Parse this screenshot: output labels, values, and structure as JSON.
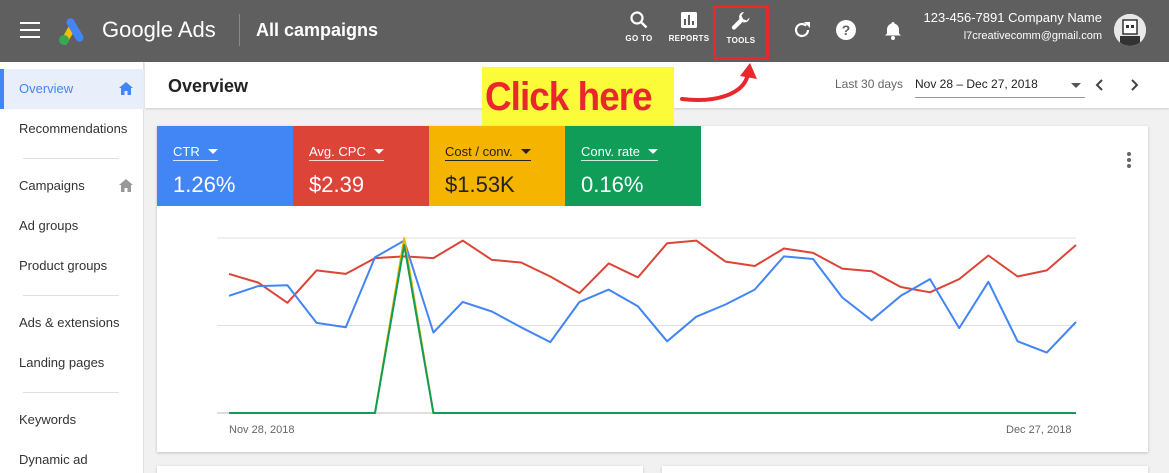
{
  "topbar": {
    "brand": "Google Ads",
    "page_title": "All campaigns",
    "buttons": {
      "goto": "GO TO",
      "reports": "REPORTS",
      "tools": "TOOLS"
    },
    "account_phone_company": "123-456-7891 Company Name",
    "account_email": "l7creativecomm@gmail.com",
    "icons": [
      "menu-icon",
      "google-ads-logo",
      "search-icon",
      "reports-icon",
      "wrench-icon",
      "refresh-icon",
      "help-icon",
      "bell-icon"
    ]
  },
  "callout": {
    "text": "Click here",
    "color": "#e8282c",
    "background": "#fbfb3a"
  },
  "sidebar": {
    "items": [
      {
        "label": "Overview",
        "active": true,
        "icon": "home-icon"
      },
      {
        "label": "Recommendations"
      },
      {
        "label": "Campaigns",
        "icon": "home-icon"
      },
      {
        "label": "Ad groups"
      },
      {
        "label": "Product groups"
      },
      {
        "label": "Ads & extensions"
      },
      {
        "label": "Landing pages"
      },
      {
        "label": "Keywords"
      },
      {
        "label": "Dynamic ad"
      }
    ]
  },
  "overview": {
    "title": "Overview",
    "range_label": "Last 30 days",
    "date_range": "Nov 28 – Dec 27, 2018"
  },
  "metrics": [
    {
      "label": "CTR",
      "value": "1.26%",
      "color": "#4285f4"
    },
    {
      "label": "Avg. CPC",
      "value": "$2.39",
      "color": "#db4437"
    },
    {
      "label": "Cost / conv.",
      "value": "$1.53K",
      "color": "#f4b400"
    },
    {
      "label": "Conv. rate",
      "value": "0.16%",
      "color": "#0f9d58"
    }
  ],
  "chart_data": {
    "type": "line",
    "x_start_label": "Nov 28, 2018",
    "x_end_label": "Dec 27, 2018",
    "x": [
      1,
      2,
      3,
      4,
      5,
      6,
      7,
      8,
      9,
      10,
      11,
      12,
      13,
      14,
      15,
      16,
      17,
      18,
      19,
      20,
      21,
      22,
      23,
      24,
      25,
      26,
      27,
      28,
      29,
      30
    ],
    "y_axis_labels": "none",
    "grid": true,
    "series": [
      {
        "name": "CTR",
        "color": "#4285f4",
        "values": [
          1.34,
          1.45,
          1.46,
          1.03,
          0.98,
          1.78,
          1.97,
          0.92,
          1.27,
          1.16,
          0.98,
          0.81,
          1.27,
          1.41,
          1.22,
          0.82,
          1.1,
          1.24,
          1.41,
          1.79,
          1.76,
          1.32,
          1.06,
          1.34,
          1.53,
          0.97,
          1.5,
          0.82,
          0.69,
          1.04
        ]
      },
      {
        "name": "Avg. CPC",
        "color": "#db4437",
        "values": [
          1.59,
          1.49,
          1.26,
          1.63,
          1.59,
          1.77,
          1.79,
          1.77,
          1.97,
          1.75,
          1.72,
          1.56,
          1.37,
          1.71,
          1.55,
          1.94,
          1.97,
          1.73,
          1.68,
          1.88,
          1.83,
          1.65,
          1.62,
          1.44,
          1.38,
          1.53,
          1.8,
          1.56,
          1.63,
          1.92
        ]
      },
      {
        "name": "Cost / conv.",
        "color": "#f4b400",
        "values": [
          0,
          0,
          0,
          0,
          0,
          0,
          2.0,
          0,
          0,
          0,
          0,
          0,
          0,
          0,
          0,
          0,
          0,
          0,
          0,
          0,
          0,
          0,
          0,
          0,
          0,
          0,
          0,
          0,
          0,
          0
        ]
      },
      {
        "name": "Conv. rate",
        "color": "#0f9d58",
        "values": [
          0,
          0,
          0,
          0,
          0,
          0,
          1.92,
          0,
          0,
          0,
          0,
          0,
          0,
          0,
          0,
          0,
          0,
          0,
          0,
          0,
          0,
          0,
          0,
          0,
          0,
          0,
          0,
          0,
          0,
          0
        ]
      }
    ],
    "ylim": [
      0,
      2
    ]
  }
}
